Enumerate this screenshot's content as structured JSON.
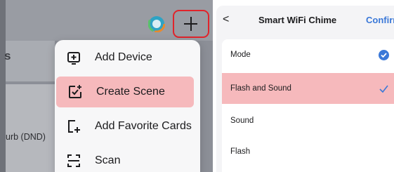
{
  "left_panel": {
    "background_partial_text": "s",
    "dnd_text": "urb (DND)",
    "add_menu": {
      "items": [
        {
          "label": "Add Device",
          "icon": "add-device-icon"
        },
        {
          "label": "Create Scene",
          "icon": "create-scene-icon",
          "highlighted": true
        },
        {
          "label": "Add Favorite Cards",
          "icon": "add-favorite-cards-icon"
        },
        {
          "label": "Scan",
          "icon": "scan-icon"
        }
      ]
    },
    "plus_button_icon": "plus-icon",
    "highlight_color": "#e0242b"
  },
  "right_panel": {
    "nav": {
      "back_label": "<",
      "title": "Smart WiFi Chime",
      "confirm_label": "Confirm"
    },
    "options": [
      {
        "label": "Mode",
        "selected": true,
        "check_style": "filled"
      },
      {
        "label": "Flash and Sound",
        "selected": true,
        "highlighted": true,
        "check_style": "plain"
      },
      {
        "label": "Sound",
        "selected": false
      },
      {
        "label": "Flash",
        "selected": false
      }
    ],
    "accent_color": "#3a78d8",
    "highlight_color": "#f6b9bc"
  }
}
